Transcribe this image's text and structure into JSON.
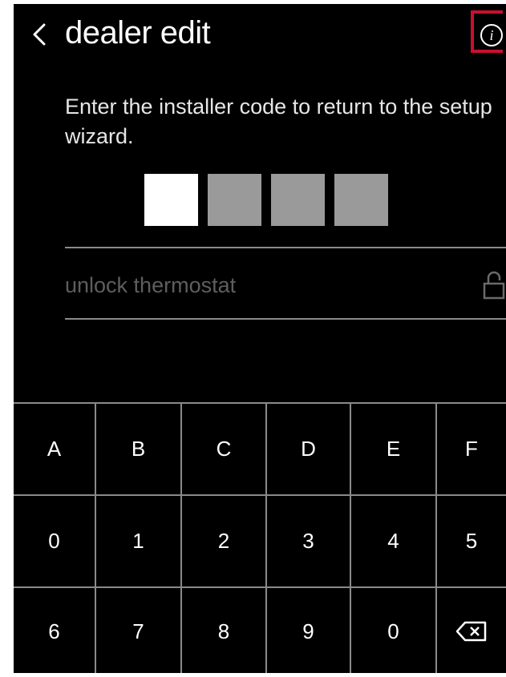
{
  "header": {
    "back_icon": "chevron-left-icon",
    "title": "dealer edit",
    "info_icon": "info-icon",
    "highlight_color": "#c8102e"
  },
  "instructions": "Enter the installer code to return to the setup wizard.",
  "code_entry": {
    "digits": 4,
    "active_index": 0,
    "active_color": "#ffffff",
    "inactive_color": "#9a9a9a"
  },
  "unlock": {
    "label": "unlock thermostat",
    "icon": "lock-icon"
  },
  "keypad": {
    "rows": [
      [
        "A",
        "B",
        "C",
        "D",
        "E",
        "F"
      ],
      [
        "0",
        "1",
        "2",
        "3",
        "4",
        "5"
      ],
      [
        "6",
        "7",
        "8",
        "9",
        "0",
        "backspace"
      ]
    ],
    "backspace_icon": "backspace-icon"
  }
}
